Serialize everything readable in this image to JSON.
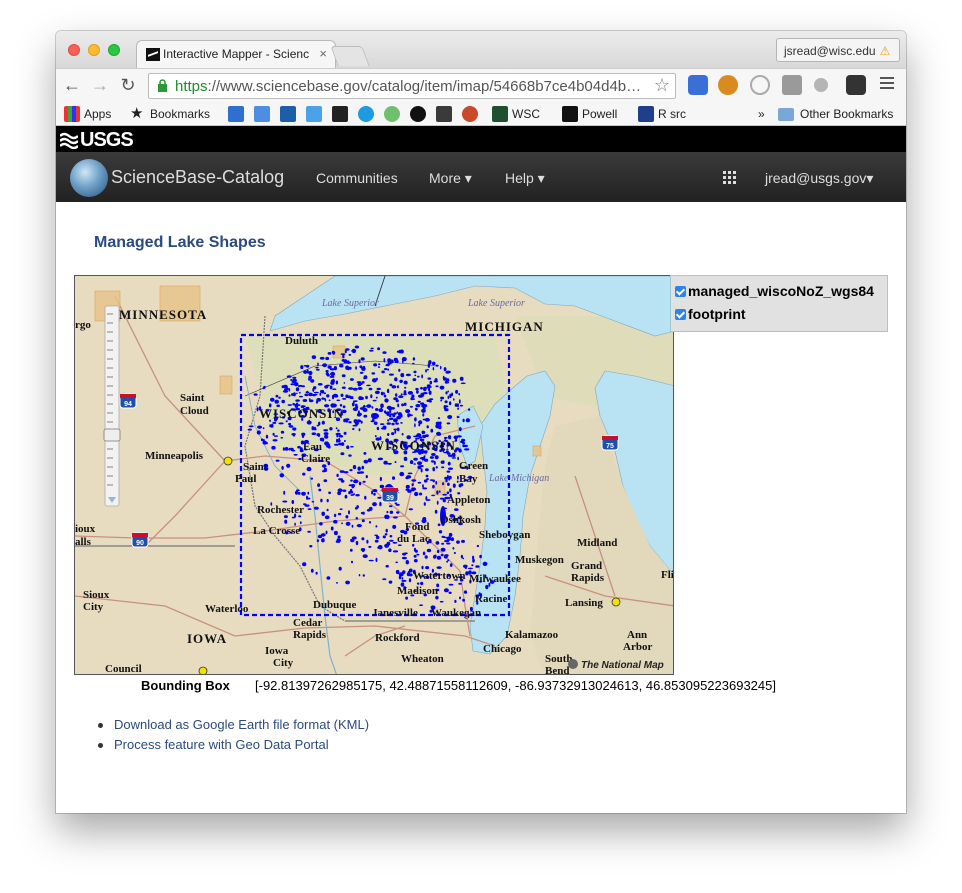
{
  "browser": {
    "tab_title": "Interactive Mapper - Scienc",
    "tab_close": "×",
    "user_chip": "jsread@wisc.edu",
    "url_scheme": "https",
    "url_rest": "://www.sciencebase.gov/catalog/item/imap/54668b7ce4b04d4b…",
    "back_icon": "back-arrow-icon",
    "forward_icon": "forward-arrow-icon",
    "reload_icon": "reload-icon"
  },
  "bookmarks": {
    "apps": "Apps",
    "bookmarks": "Bookmarks",
    "wsc": "WSC",
    "powell": "Powell",
    "rsrc": "R src",
    "more": "»",
    "other": "Other Bookmarks"
  },
  "usgs": {
    "logo": "USGS"
  },
  "nav": {
    "brand": "ScienceBase-Catalog",
    "communities": "Communities",
    "more": "More ▾",
    "help": "Help ▾",
    "user": "jread@usgs.gov▾"
  },
  "page": {
    "title": "Managed Lake Shapes",
    "bbox_label": "Bounding Box",
    "bbox_value": "[-92.81397262985175, 42.48871558112609, -86.93732913024613, 46.853095223693245]",
    "links": [
      "Download as Google Earth file format (KML)",
      "Process feature with Geo Data Portal"
    ]
  },
  "layers": [
    {
      "name": "managed_wiscoNoZ_wgs84",
      "checked": true
    },
    {
      "name": "footprint",
      "checked": true
    }
  ],
  "map": {
    "labels": {
      "minnesota": "MINNESOTA",
      "michigan": "MICHIGAN",
      "wisconsin": "WISCONSIN",
      "iowa": "IOWA",
      "lake_superior": "Lake Superior",
      "lake_michigan": "Lake Michigan",
      "duluth": "Duluth",
      "saint_cloud_1": "Saint",
      "saint_cloud_2": "Cloud",
      "minneapolis": "Minneapolis",
      "saint_paul_1": "Saint",
      "saint_paul_2": "Paul",
      "eau_claire_1": "Eau",
      "eau_claire_2": "Claire",
      "green_bay_1": "Green",
      "green_bay_2": "Bay",
      "appleton": "Appleton",
      "oshkosh": "Oshkosh",
      "fond_du_lac_1": "Fond",
      "fond_du_lac_2": "du Lac",
      "sheboygan": "Sheboygan",
      "rochester": "Rochester",
      "la_crosse": "La Crosse",
      "sioux_falls_1": "ioux",
      "sioux_falls_2": "alls",
      "sioux_city_1": "Sioux",
      "sioux_city_2": "City",
      "waterloo": "Waterloo",
      "dubuque": "Dubuque",
      "cedar_rapids_1": "Cedar",
      "cedar_rapids_2": "Rapids",
      "iowa_city_1": "Iowa",
      "iowa_city_2": "City",
      "council": "Council",
      "madison": "Madison",
      "watertown": "Watertown",
      "janesville": "Janesville",
      "milwaukee": "Milwaukee",
      "racine": "Racine",
      "waukegan": "Waukegan",
      "rockford": "Rockford",
      "wheaton": "Wheaton",
      "chicago": "Chicago",
      "kalamazoo": "Kalamazoo",
      "muskegon": "Muskegon",
      "grand_rapids_1": "Grand",
      "grand_rapids_2": "Rapids",
      "midland": "Midland",
      "lansing": "Lansing",
      "ann_arbor_1": "Ann",
      "ann_arbor_2": "Arbor",
      "south_bend_1": "South",
      "south_bend_2": "Bend",
      "fli": "Fli",
      "fargo": "rgo",
      "i94": "94",
      "i39": "39",
      "i75": "75",
      "i90": "90",
      "attribution": "The National Map"
    }
  }
}
